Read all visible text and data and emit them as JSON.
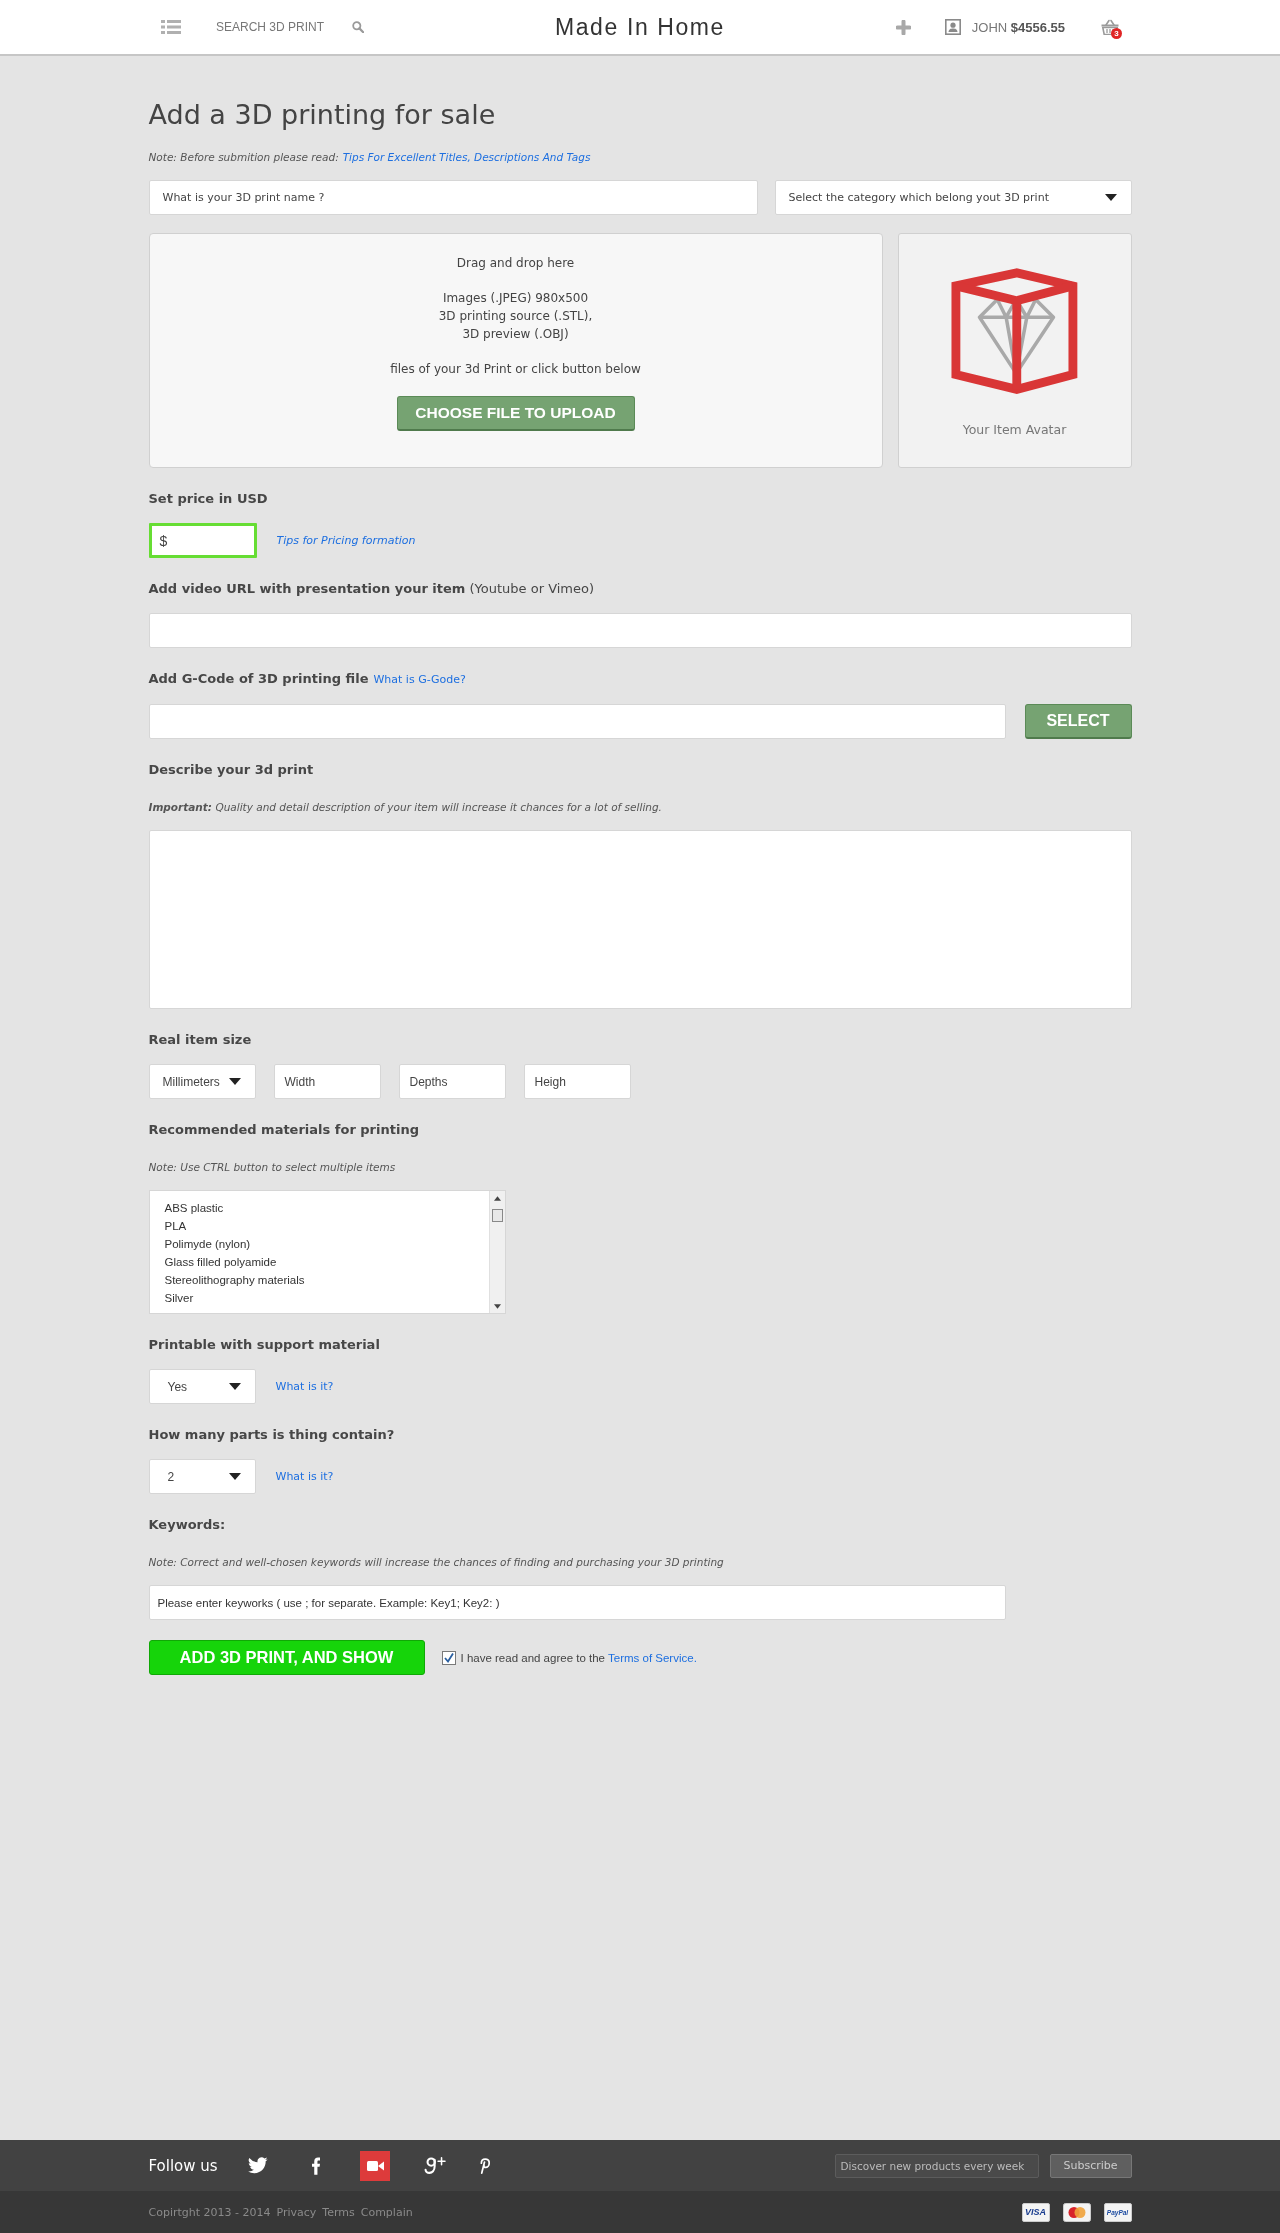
{
  "header": {
    "search_label": "SEARCH 3D PRINT",
    "logo": "Made In Home",
    "user": "JOHN **$4556.55**",
    "cart_count": "3"
  },
  "page": {
    "title": "Add a 3D printing for sale",
    "note": "Note: Before submition please read:",
    "note_link": "Tips For Excellent Titles, Descriptions And Tags"
  },
  "name_field": {
    "placeholder": "What is your 3D print name ?"
  },
  "category_select": {
    "value": "Select the category which belong yout 3D print"
  },
  "upload": {
    "paragraphs": [
      [
        "Drag and drop here"
      ],
      [
        "Images (.JPEG) 980x500",
        "3D printing source (.STL),",
        "3D preview (.OBJ)"
      ],
      [
        "files of your 3d Print or click button below"
      ]
    ],
    "button": "CHOOSE FILE TO UPLOAD"
  },
  "avatar": {
    "caption": "Your Item Avatar"
  },
  "price": {
    "label": "Set price in USD",
    "value": "$",
    "focused": true,
    "link": "Tips for Pricing formation"
  },
  "video": {
    "label": "**Add video URL with presentation your item** (Youtube or Vimeo)"
  },
  "gcode": {
    "label": "Add G-Code of 3D printing file",
    "link": "What is G-Gode?",
    "button": "SELECT"
  },
  "description": {
    "label": "Describe your 3d print",
    "note": "**Important:** Quality and detail description of your item will increase it chances for a lot of selling."
  },
  "size": {
    "label": "Real item size",
    "controls": [
      {
        "kind": "select",
        "value": "Millimeters"
      },
      {
        "kind": "input",
        "placeholder": "Width"
      },
      {
        "kind": "input",
        "placeholder": "Depths"
      },
      {
        "kind": "input",
        "placeholder": "Heigh"
      }
    ]
  },
  "materials": {
    "label": "Recommended materials for printing",
    "note": "Note: Use CTRL button to select multiple items",
    "options": [
      {
        "label": "ABS plastic",
        "selected": false
      },
      {
        "label": "PLA",
        "selected": false
      },
      {
        "label": "Polimyde (nylon)",
        "selected": false
      },
      {
        "label": "Glass filled polyamide",
        "selected": false
      },
      {
        "label": "Stereolithography materials",
        "selected": false
      },
      {
        "label": "Silver",
        "selected": false
      }
    ]
  },
  "support": {
    "label": "Printable with support material",
    "value": "Yes",
    "link": "What is it?"
  },
  "parts": {
    "label": "How many parts is thing contain?",
    "value": "2",
    "link": "What is it?"
  },
  "keywords": {
    "label": "Keywords:",
    "note": "Note: Correct and well-chosen keywords will increase the chances of finding and purchasing your 3D printing",
    "placeholder": "Please enter keyworks ( use ; for separate. Example: Key1; Key2: )"
  },
  "submit": {
    "button": "ADD 3D PRINT, AND SHOW",
    "agree": {
      "checked": true,
      "text": "I have read and agree to the",
      "link": "Terms of Service."
    }
  },
  "footer": {
    "follow_label": "Follow us",
    "newsletter": {
      "placeholder": "Discover new products every week",
      "button": "Subscribe"
    },
    "copyright": "Copirtght 2013 - 2014",
    "links": [
      "Privacy",
      "Terms",
      "Complain"
    ],
    "payments": {
      "visa": "VISA",
      "paypal": "PayPal"
    }
  }
}
